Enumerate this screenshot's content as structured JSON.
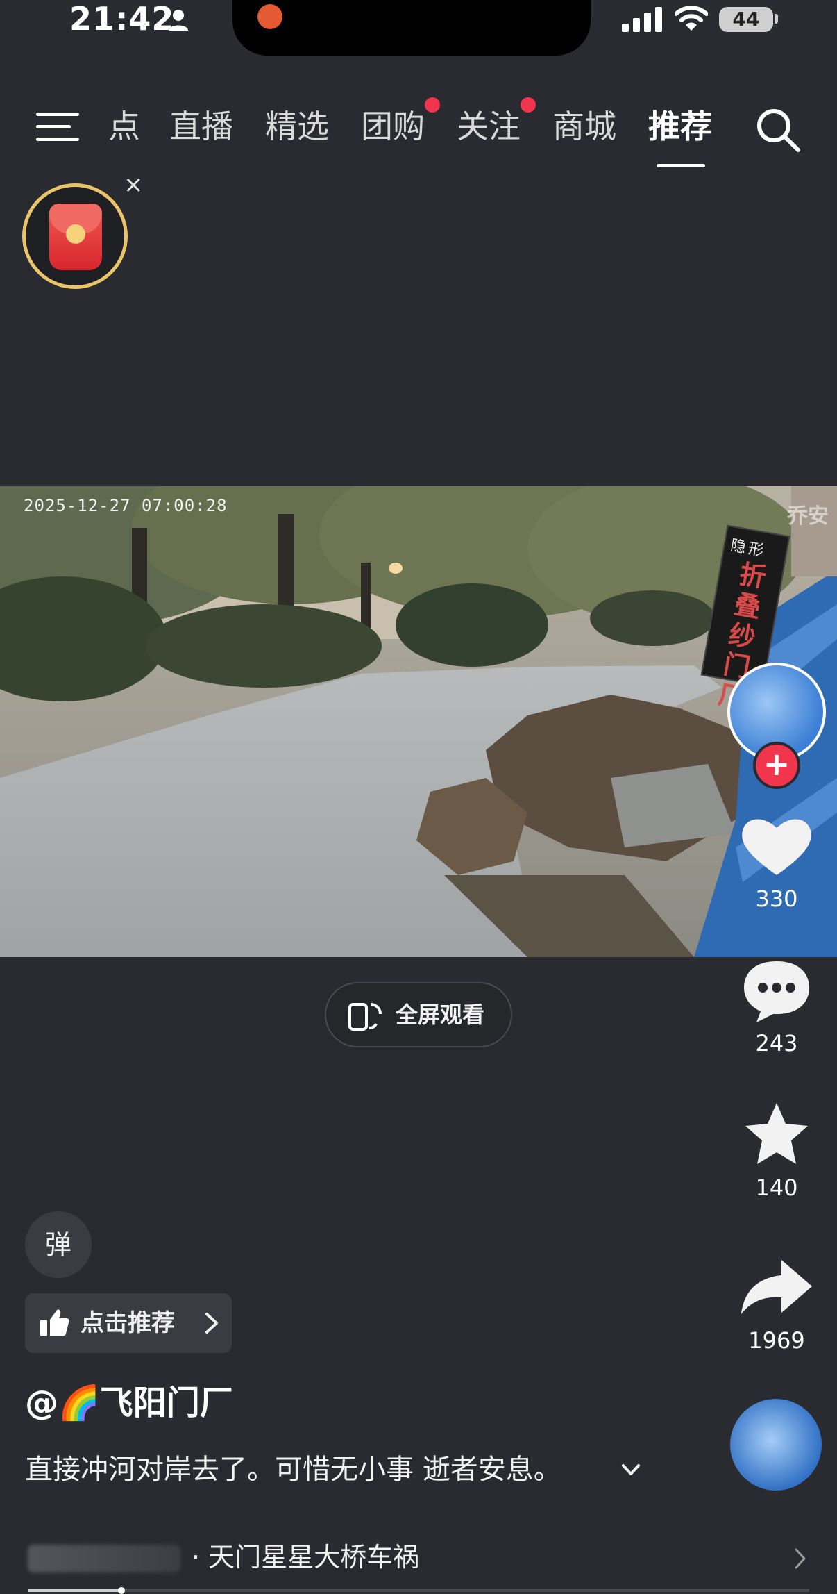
{
  "status_bar": {
    "time": "21:42",
    "battery": "44"
  },
  "nav": {
    "tabs": [
      {
        "label": "点",
        "active": false,
        "dot": false
      },
      {
        "label": "直播",
        "active": false,
        "dot": false
      },
      {
        "label": "精选",
        "active": false,
        "dot": false
      },
      {
        "label": "团购",
        "active": false,
        "dot": true
      },
      {
        "label": "关注",
        "active": false,
        "dot": true
      },
      {
        "label": "商城",
        "active": false,
        "dot": false
      },
      {
        "label": "推荐",
        "active": true,
        "dot": false
      }
    ]
  },
  "red_packet": {
    "close_glyph": "×"
  },
  "video": {
    "timestamp": "2025-12-27 07:00:28",
    "watermark": "乔安",
    "sign_small": "隐形",
    "sign_big": "折叠纱门厂"
  },
  "fullscreen": {
    "label": "全屏观看"
  },
  "actions": {
    "likes": "330",
    "comments": "243",
    "favorites": "140",
    "shares": "1969"
  },
  "info": {
    "danmu_label": "弹",
    "recommend_label": "点击推荐",
    "author": "@🌈飞阳门厂",
    "caption": "直接冲河对岸去了。可惜无小事 逝者安息。",
    "related_topic": "· 天门星星大桥车祸"
  },
  "playback": {
    "progress_fraction": 0.12
  },
  "colors": {
    "background": "#2a2b30",
    "accent_red": "#f1354d",
    "ring_gold": "#e9c46a"
  }
}
